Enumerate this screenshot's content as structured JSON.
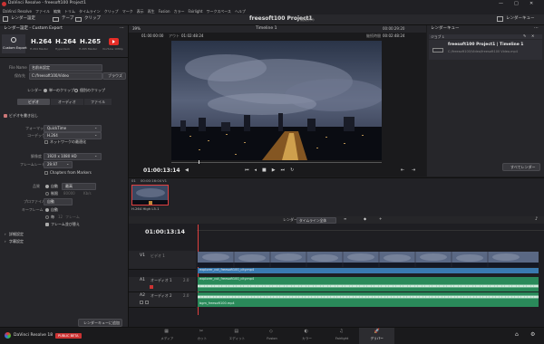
{
  "titlebar": {
    "title": "DaVinci Resolve - freesoft100 Project1",
    "min": "—",
    "max": "□",
    "close": "✕"
  },
  "menubar": [
    "DaVinci Resolve",
    "ファイル",
    "編集",
    "トリム",
    "タイムライン",
    "クリップ",
    "マーク",
    "表示",
    "再生",
    "Fusion",
    "カラー",
    "Fairlight",
    "ワークスペース",
    "ヘルプ"
  ],
  "toolbar": {
    "render_settings": "レンダー設定",
    "tape": "テープ",
    "clip": "クリップ",
    "project_title": "freesoft100 Project1",
    "edited": "編集済み",
    "render_queue": "レンダーキュー"
  },
  "render_panel": {
    "header": "レンダー設定 - Custom Export",
    "presets": [
      {
        "name": "Custom Export",
        "sub": ""
      },
      {
        "name": "H.264",
        "sub": "H.264 Master"
      },
      {
        "name": "H.264",
        "sub": "Hyperdeck"
      },
      {
        "name": "H.265",
        "sub": "H.265 Master"
      },
      {
        "name": "YouTube",
        "sub": "YouTube 1080p"
      }
    ],
    "filename_label": "File Name",
    "filename_value": "名前未設定",
    "location_label": "保存先",
    "location_value": "C:/freesoft100/Video",
    "browse": "ブラウズ",
    "render_label": "レンダー",
    "single_clip": "単一のクリップ",
    "individual_clips": "個別のクリップ",
    "tabs": [
      "ビデオ",
      "オーディオ",
      "ファイル"
    ],
    "export_video": "ビデオを書き出し",
    "format_label": "フォーマット",
    "format_value": "QuickTime",
    "codec_label": "コーデック",
    "codec_value": "H.264",
    "network_opt": "ネットワークの最適化",
    "resolution_label": "解像度",
    "resolution_value": "1920 x 1080 HD",
    "framerate_label": "フレームレート",
    "framerate_value": "29.97",
    "chapters": "Chapters from Markers",
    "quality_label": "品質",
    "quality_auto": "自動",
    "quality_value": "最高",
    "limit_label": "制限",
    "limit_value": "80000",
    "limit_unit": "Kb/s",
    "profile_label": "プロファイル",
    "profile_value": "自動",
    "keyframes_label": "キーフレーム",
    "keyframes_auto": "自動",
    "every_label": "毎",
    "every_value": "12",
    "every_unit": "フレーム",
    "frame_reorder": "フレーム並び替え",
    "advanced": "詳細設定",
    "subtitle": "字幕設定",
    "add_queue": "レンダーキューに追加"
  },
  "viewer": {
    "zoom": "39%",
    "timecode_left": "01:00:00:00",
    "marker_label": "アウト",
    "timecode_out": "01:02:48:24",
    "timeline_name": "Timeline 1",
    "timecode_right": "00:00:29:20",
    "duration_label": "継続時間",
    "timecode_right2": "00:02:48:24",
    "current_tc": "01:00:13:14",
    "render_btn": "すべてレンダー"
  },
  "queue": {
    "title": "レンダーキュー",
    "job_label": "ジョブ 1",
    "job_name": "freesoft100 Project1 | Timeline 1",
    "job_path": "C:/freesoft100/Video/freesoft100 Video.mp4"
  },
  "clip_strip": {
    "index": "01",
    "tc": "00:00:16:04",
    "num": "V1",
    "codec": "H.264 High L5.1"
  },
  "timeline": {
    "tc": "01:00:13:14",
    "render_select": "レンダー",
    "render_value": "タイムライン全体",
    "tracks": [
      {
        "id": "V1",
        "name": "ビデオ 1"
      },
      {
        "id": "A1",
        "name": "オーディオ 1",
        "ch": "2.0"
      },
      {
        "id": "A2",
        "name": "オーディオ 2",
        "ch": "2.0"
      }
    ],
    "clip_v": "explorer_cut_freesoft100_city.mp4",
    "clip_a1": "explorer_cut_freesoft100_city.mp4",
    "clip_a2": "bgm_freesoft100.mp4"
  },
  "bottom": {
    "app": "DaVinci Resolve 18",
    "beta": "PUBLIC BETA",
    "pages": [
      "メディア",
      "カット",
      "エディット",
      "Fusion",
      "カラー",
      "Fairlight",
      "デリバー"
    ],
    "active_page": 6
  },
  "colors": {
    "accent": "#e2c66c",
    "video_clip": "#3a7ab0",
    "audio_clip": "#2a8a5a",
    "active_tab": "#c44"
  }
}
